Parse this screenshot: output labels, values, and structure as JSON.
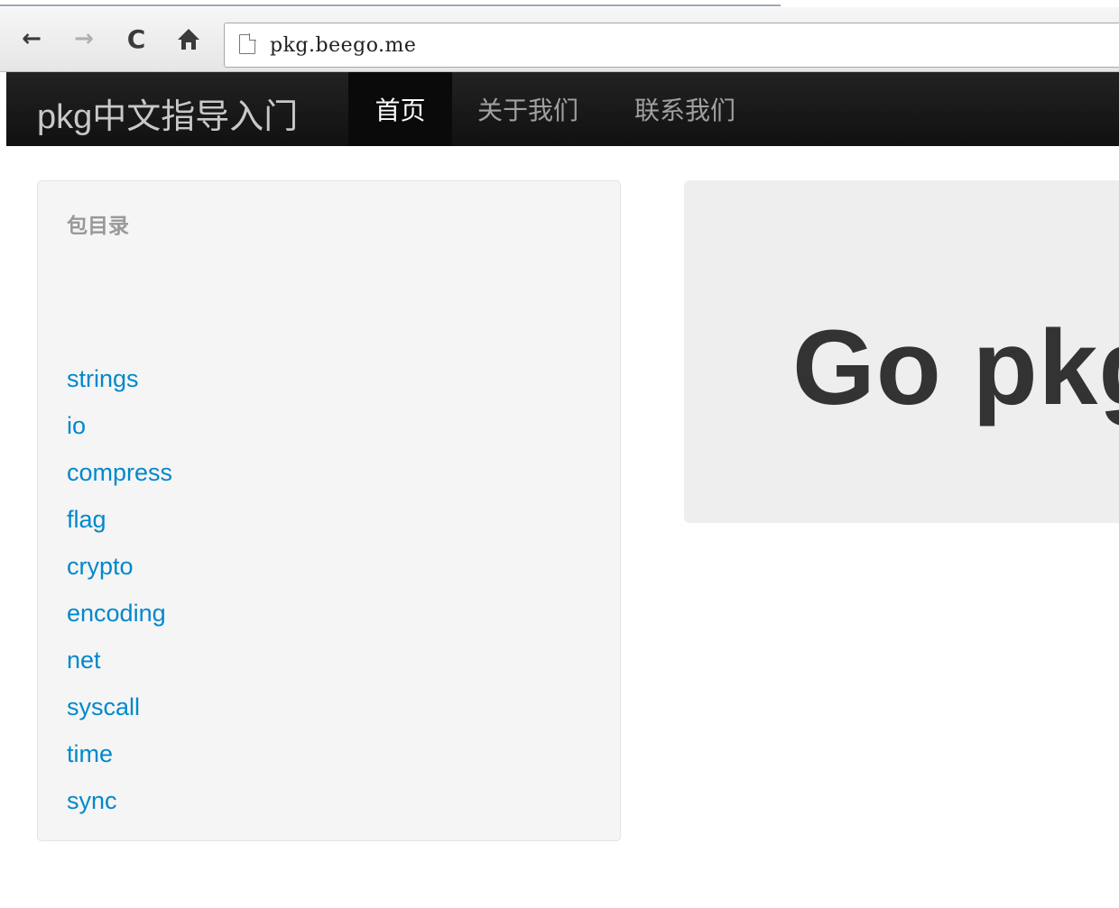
{
  "browser": {
    "url": "pkg.beego.me",
    "back_icon": "←",
    "forward_icon": "→",
    "reload_icon": "C",
    "home_icon": "home-icon"
  },
  "navbar": {
    "brand": "pkg中文指导入门",
    "items": [
      {
        "label": "首页",
        "active": true
      },
      {
        "label": "关于我们",
        "active": false
      },
      {
        "label": "联系我们",
        "active": false
      }
    ]
  },
  "sidebar": {
    "header": "包目录",
    "packages": [
      "strings",
      "io",
      "compress",
      "flag",
      "crypto",
      "encoding",
      "net",
      "syscall",
      "time",
      "sync"
    ]
  },
  "hero": {
    "title": "Go pkg"
  },
  "colors": {
    "link": "#0088cc",
    "navbar": "#1b1b1b",
    "hero_bg": "#eeeeee",
    "sidebar_bg": "#f5f5f5"
  }
}
